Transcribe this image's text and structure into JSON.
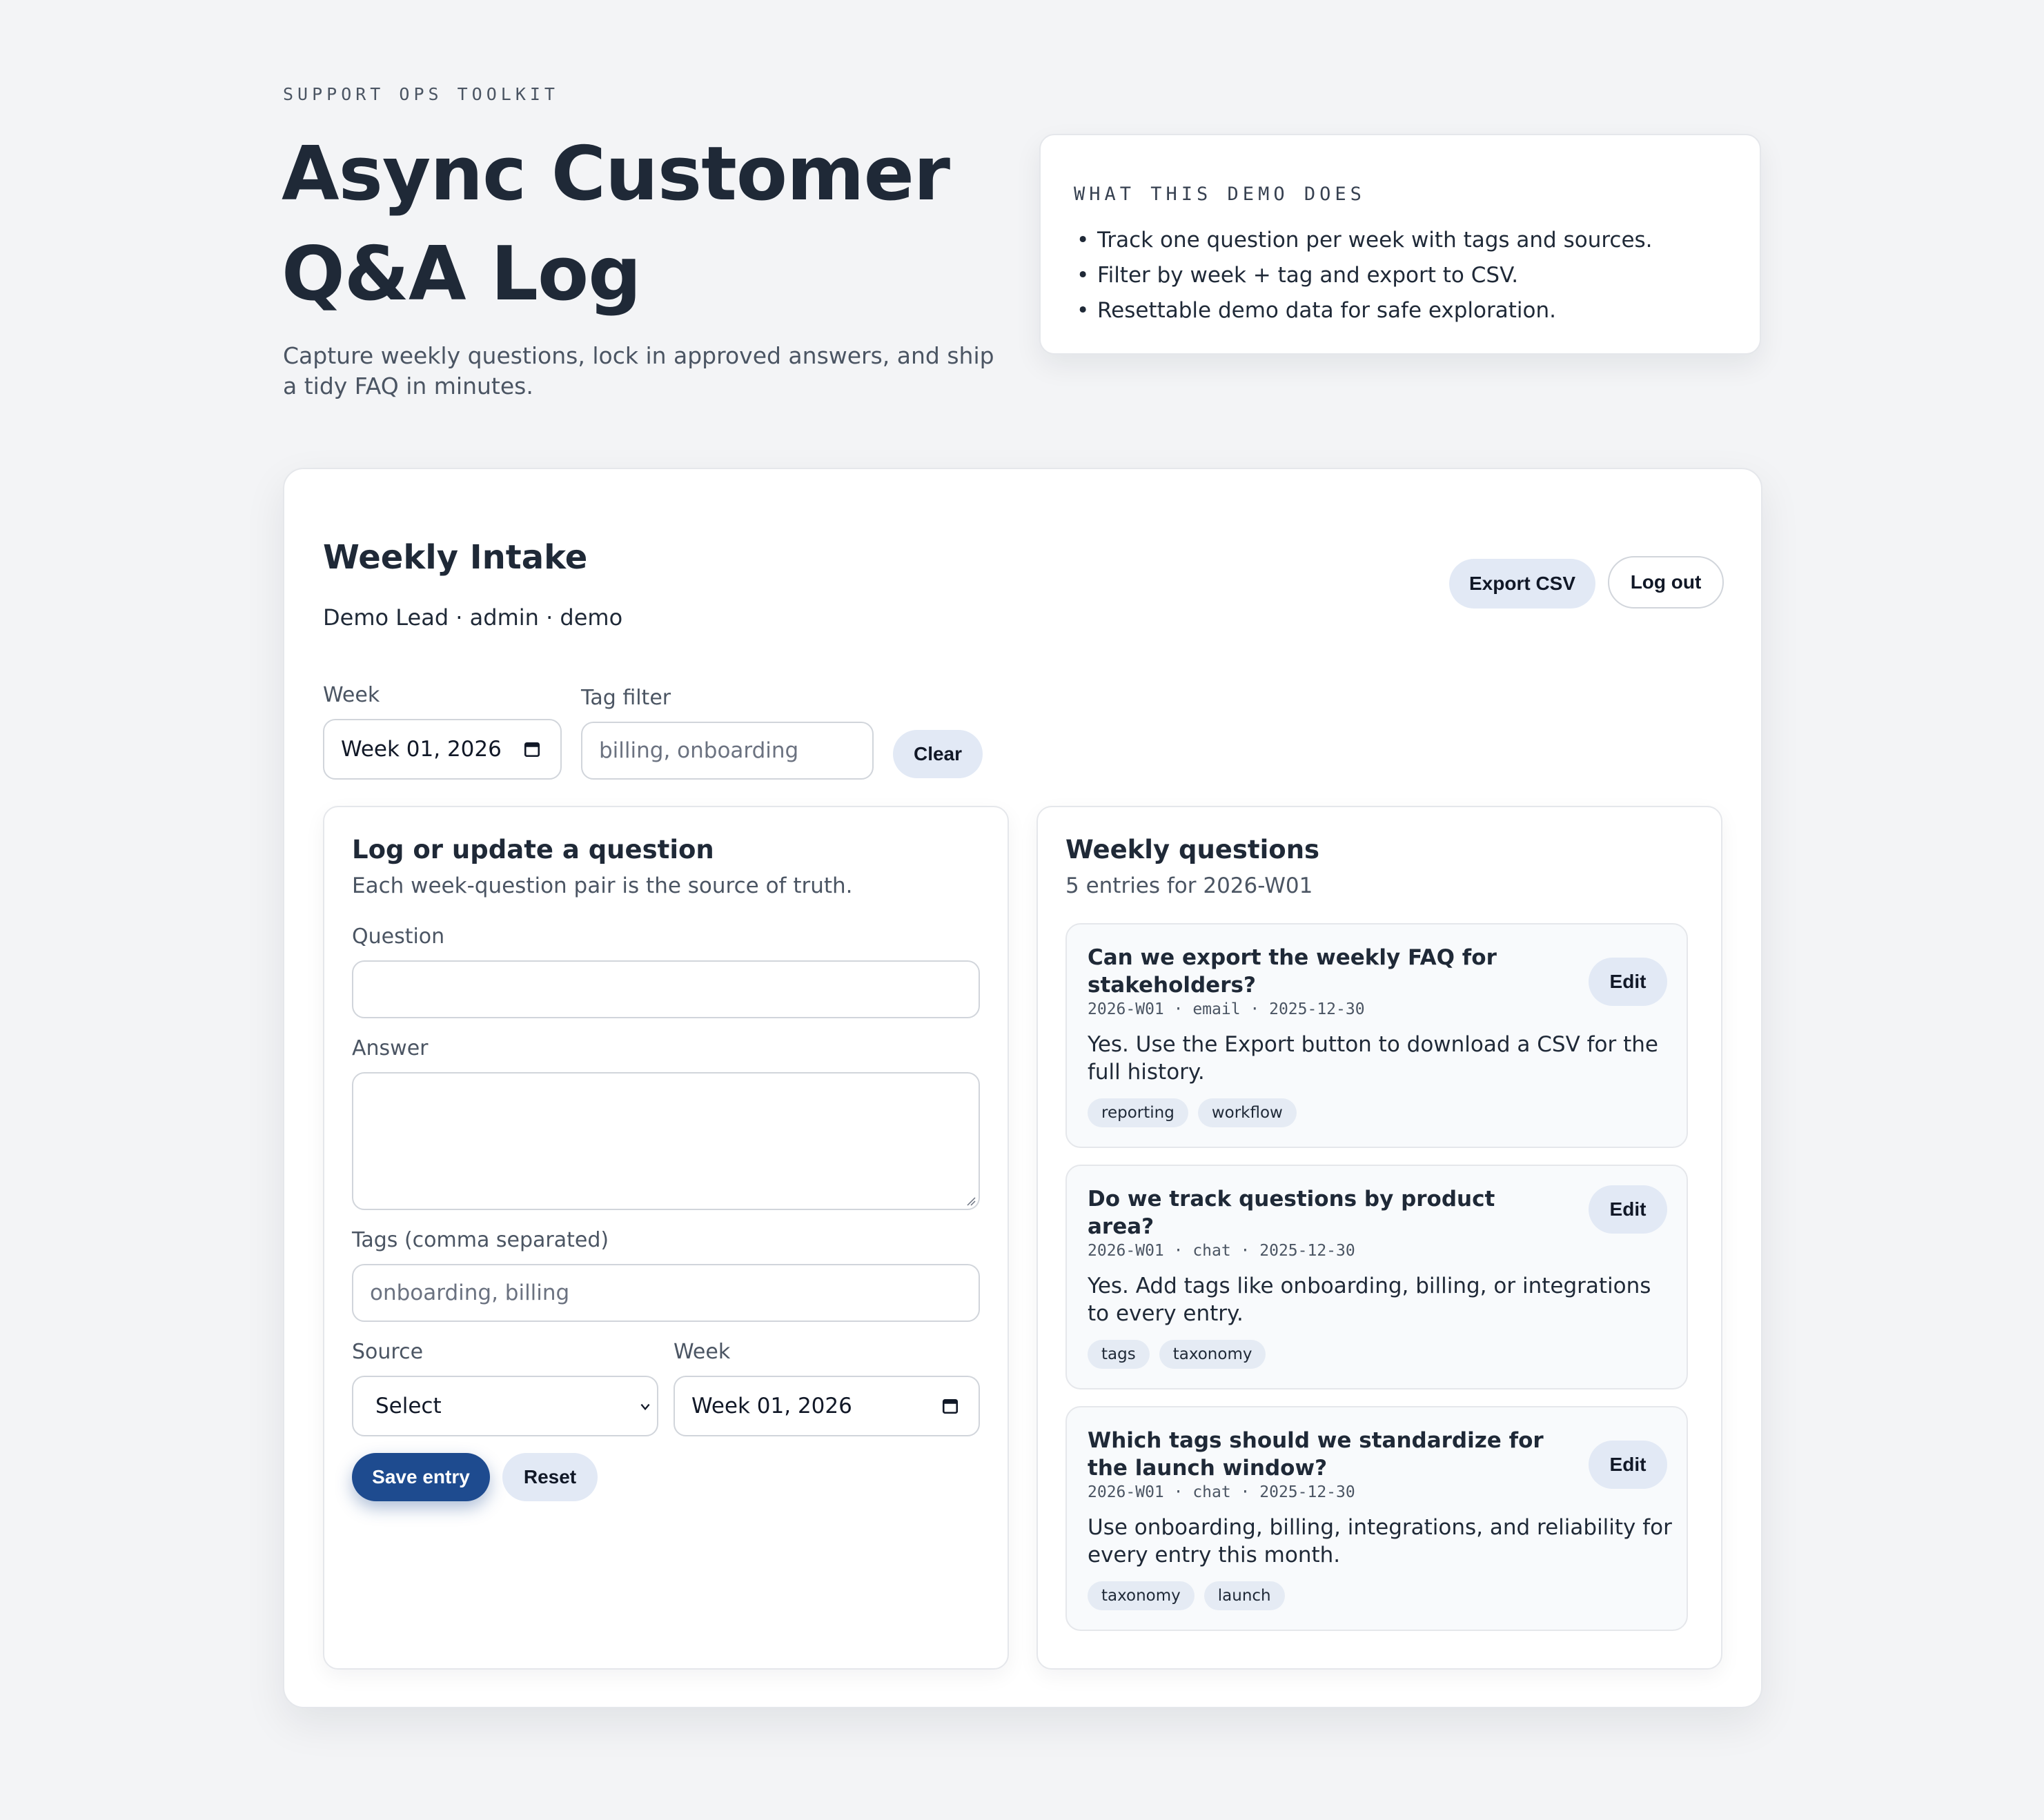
{
  "hero": {
    "eyebrow": "SUPPORT OPS TOOLKIT",
    "title": "Async Customer Q&A Log",
    "subtitle": "Capture weekly questions, lock in approved answers, and ship a tidy FAQ in minutes."
  },
  "info_card": {
    "heading": "WHAT THIS DEMO DOES",
    "items": [
      "Track one question per week with tags and sources.",
      "Filter by week + tag and export to CSV.",
      "Resettable demo data for safe exploration."
    ]
  },
  "intake": {
    "title": "Weekly Intake",
    "user_line": "Demo Lead · admin · demo",
    "export_label": "Export CSV",
    "logout_label": "Log out",
    "filters": {
      "week_label": "Week",
      "week_value": "Week 01, 2026",
      "tag_label": "Tag filter",
      "tag_placeholder": "billing, onboarding",
      "clear_label": "Clear"
    }
  },
  "form": {
    "title": "Log or update a question",
    "subtitle": "Each week-question pair is the source of truth.",
    "question_label": "Question",
    "question_value": "",
    "answer_label": "Answer",
    "answer_value": "",
    "tags_label": "Tags (comma separated)",
    "tags_placeholder": "onboarding, billing",
    "source_label": "Source",
    "source_value": "Select",
    "week_label": "Week",
    "week_value": "Week 01, 2026",
    "save_label": "Save entry",
    "reset_label": "Reset"
  },
  "weekly": {
    "title": "Weekly questions",
    "summary": "5 entries for 2026-W01",
    "edit_label": "Edit",
    "entries": [
      {
        "question": "Can we export the weekly FAQ for stakeholders?",
        "meta": "2026-W01 · email · 2025-12-30",
        "answer": "Yes. Use the Export button to download a CSV for the full history.",
        "tags": [
          "reporting",
          "workflow"
        ]
      },
      {
        "question": "Do we track questions by product area?",
        "meta": "2026-W01 · chat · 2025-12-30",
        "answer": "Yes. Add tags like onboarding, billing, or integrations to every entry.",
        "tags": [
          "tags",
          "taxonomy"
        ]
      },
      {
        "question": "Which tags should we standardize for the launch window?",
        "meta": "2026-W01 · chat · 2025-12-30",
        "answer": "Use onboarding, billing, integrations, and reliability for every entry this month.",
        "tags": [
          "taxonomy",
          "launch"
        ]
      }
    ]
  },
  "colors": {
    "background": "#f3f4f6",
    "primary_button": "#1e4b8f",
    "soft_button": "#e2e9f5",
    "text": "#1f2937"
  },
  "icons": {
    "calendar": "calendar-icon",
    "chevron": "chevron-down-icon"
  }
}
